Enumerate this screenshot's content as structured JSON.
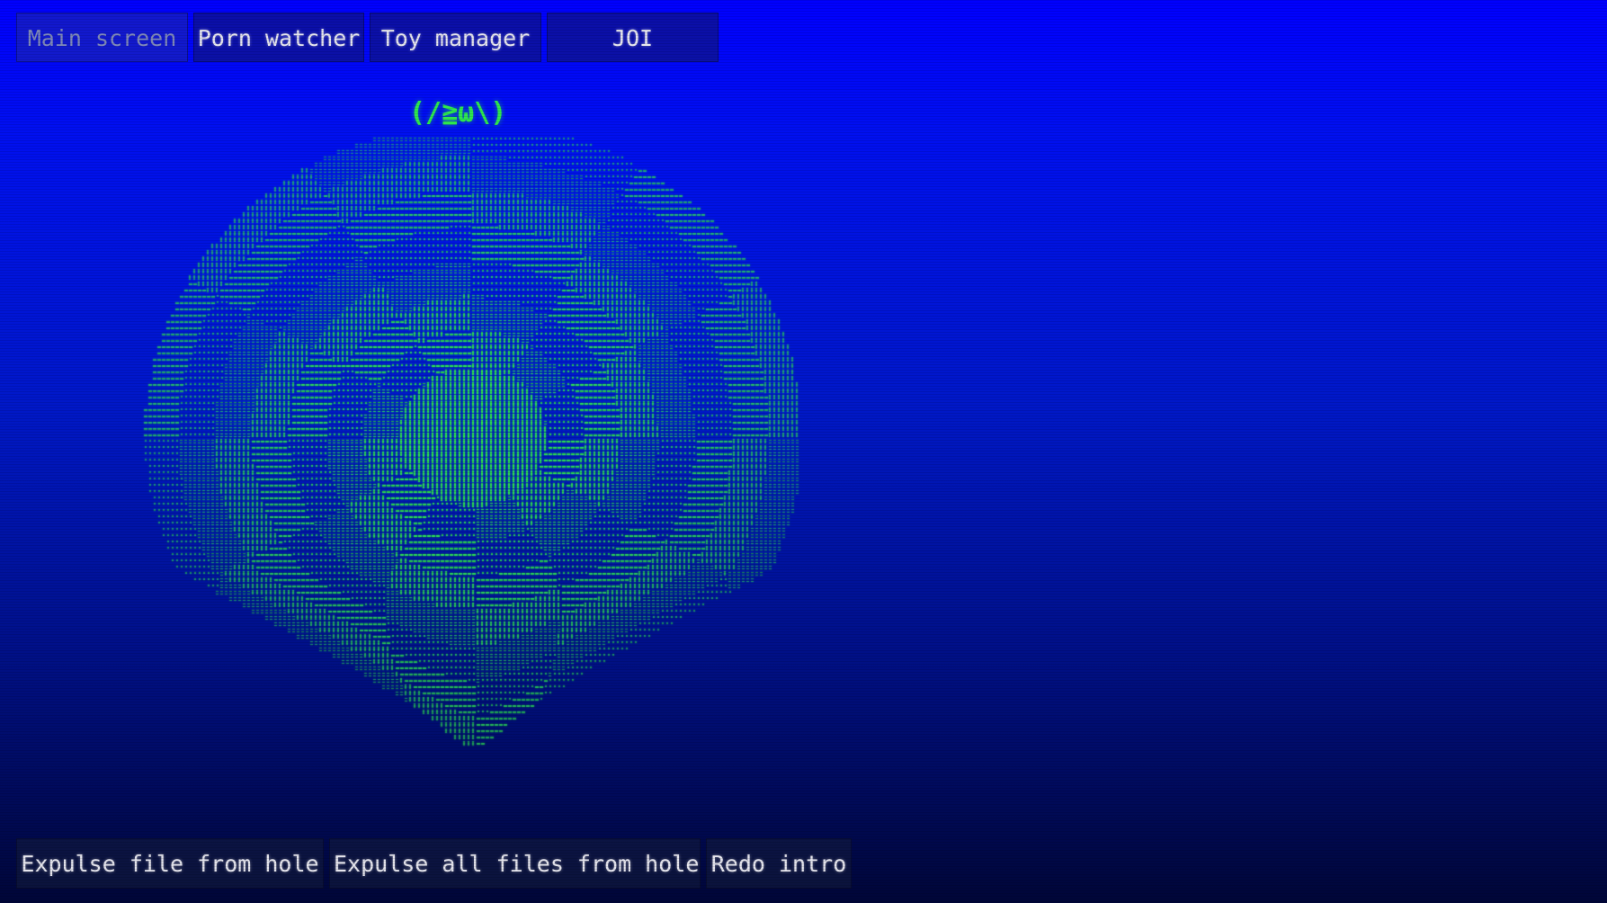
{
  "tabs": [
    {
      "label": "Main screen",
      "active": true
    },
    {
      "label": "Porn watcher",
      "active": false
    },
    {
      "label": "Toy manager",
      "active": false
    },
    {
      "label": "JOI",
      "active": false
    }
  ],
  "mascot": {
    "face": "(/≧ω\\)"
  },
  "hole_visual": {
    "icon": "ascii-spiral-hole",
    "color": "#2ee84e"
  },
  "actions": {
    "expulse_one": "Expulse file from hole",
    "expulse_all": "Expulse all files from hole",
    "redo_intro": "Redo intro"
  },
  "colors": {
    "text": "#e6e6ee",
    "inactive_text": "#7f89b8",
    "accent_green": "#2ee84e",
    "background_top": "#0000ff",
    "background_bottom": "#000638"
  }
}
